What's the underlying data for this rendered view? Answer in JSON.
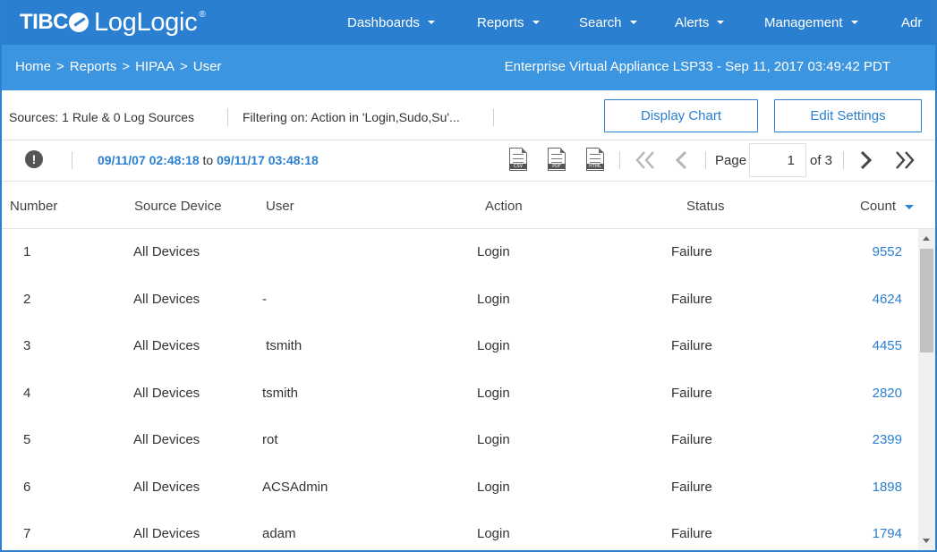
{
  "brand": {
    "prefix": "TIBC",
    "name": "LogLogic",
    "reg": "®"
  },
  "nav": {
    "items": [
      {
        "label": "Dashboards"
      },
      {
        "label": "Reports"
      },
      {
        "label": "Search"
      },
      {
        "label": "Alerts"
      },
      {
        "label": "Management"
      },
      {
        "label": "Adr"
      }
    ]
  },
  "breadcrumb": {
    "items": [
      "Home",
      "Reports",
      "HIPAA",
      "User"
    ],
    "separator": ">"
  },
  "appliance": "Enterprise Virtual Appliance LSP33 - Sep 11, 2017 03:49:42 PDT",
  "filters": {
    "sources": "Sources: 1 Rule & 0 Log Sources",
    "filtering": "Filtering on: Action in 'Login,Sudo,Su'...",
    "display_chart": "Display Chart",
    "edit_settings": "Edit Settings"
  },
  "toolbar": {
    "alert_glyph": "!",
    "date_from": "09/11/07 02:48:18",
    "date_to_word": "to",
    "date_to": "09/11/17 03:48:18",
    "exports": [
      "CSV",
      "PDF",
      "HTML"
    ],
    "page_label": "Page",
    "page_value": "1",
    "of_pages": "of 3"
  },
  "table": {
    "columns": [
      "Number",
      "Source Device",
      "User",
      "Action",
      "Status",
      "Count"
    ],
    "sorted_column": "Count",
    "rows": [
      {
        "number": "1",
        "device": "All Devices",
        "user": "",
        "action": "Login",
        "status": "Failure",
        "count": "9552"
      },
      {
        "number": "2",
        "device": "All Devices",
        "user": "-",
        "action": "Login",
        "status": "Failure",
        "count": "4624"
      },
      {
        "number": "3",
        "device": "All Devices",
        "user": " tsmith",
        "action": "Login",
        "status": "Failure",
        "count": "4455"
      },
      {
        "number": "4",
        "device": "All Devices",
        "user": "tsmith",
        "action": "Login",
        "status": "Failure",
        "count": "2820"
      },
      {
        "number": "5",
        "device": "All Devices",
        "user": "rot",
        "action": "Login",
        "status": "Failure",
        "count": "2399"
      },
      {
        "number": "6",
        "device": "All Devices",
        "user": "ACSAdmin",
        "action": "Login",
        "status": "Failure",
        "count": "1898"
      },
      {
        "number": "7",
        "device": "All Devices",
        "user": "adam",
        "action": "Login",
        "status": "Failure",
        "count": "1794"
      }
    ]
  },
  "colors": {
    "nav_bg": "#2b7fd0",
    "crumb_bg": "#3b95e0",
    "link": "#2b7fd0"
  }
}
